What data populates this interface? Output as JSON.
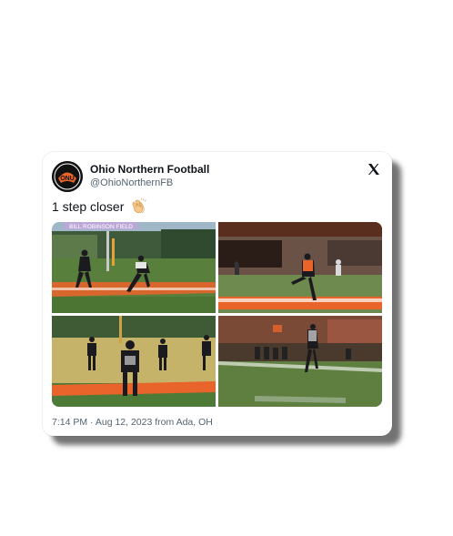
{
  "tweet": {
    "display_name": "Ohio Northern Football",
    "handle": "@OhioNorthernFB",
    "text": "1 step closer",
    "emoji_icon": "clapping-hands-icon",
    "timestamp": "7:14 PM · Aug 12, 2023 from Ada, OH",
    "avatar_text": "ONU",
    "platform_icon": "x-logo-icon",
    "banner_text": "BILL ROBINSON FIELD"
  },
  "colors": {
    "onu_orange": "#e8642a",
    "turf_green": "#4f7a38",
    "jersey_black": "#1b1b1f"
  }
}
